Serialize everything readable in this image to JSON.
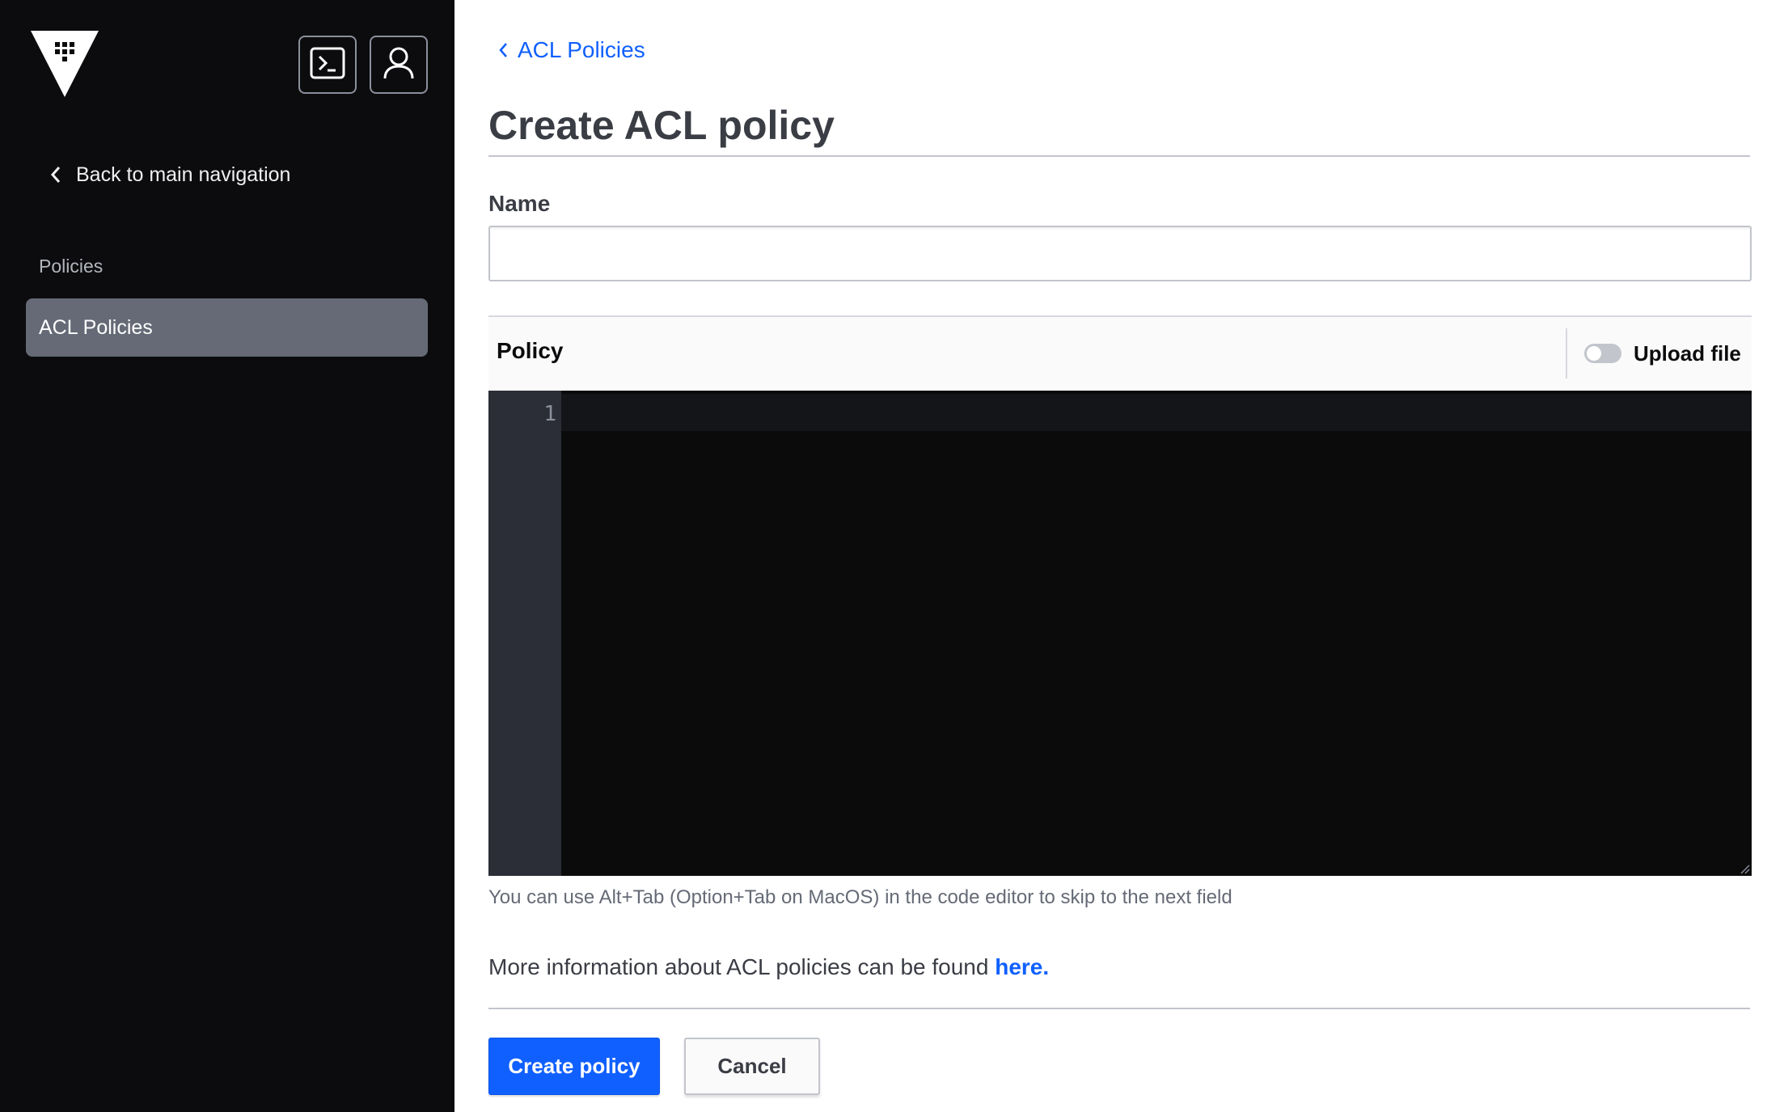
{
  "sidebar": {
    "logo_icon": "vault-logo-icon",
    "console_icon": "terminal-icon",
    "user_icon": "user-icon",
    "back_label": "Back to main navigation",
    "section_heading": "Policies",
    "items": [
      {
        "label": "ACL Policies",
        "active": true
      }
    ]
  },
  "main": {
    "breadcrumb": "ACL Policies",
    "title": "Create ACL policy",
    "name_field": {
      "label": "Name",
      "value": "",
      "placeholder": ""
    },
    "policy": {
      "label": "Policy",
      "upload_label": "Upload file",
      "upload_enabled": false,
      "line_numbers": [
        "1"
      ]
    },
    "helper_text": "You can use Alt+Tab (Option+Tab on MacOS) in the code editor to skip to the next field",
    "more_info_text": "More information about ACL policies can be found ",
    "more_info_link": "here.",
    "buttons": {
      "create": "Create policy",
      "cancel": "Cancel"
    }
  },
  "colors": {
    "sidebar_bg": "#0c0c0e",
    "active_item_bg": "#656a76",
    "link": "#1060ff",
    "primary_button": "#1060ff",
    "editor_bg": "#0b0b0c",
    "gutter_bg": "#2b2e36"
  }
}
